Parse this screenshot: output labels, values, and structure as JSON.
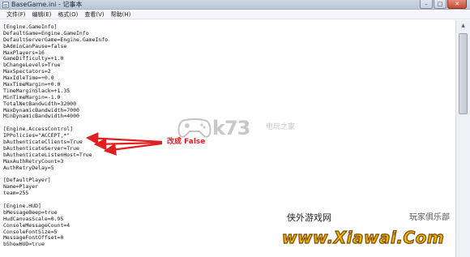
{
  "window": {
    "title": "BaseGame.ini - 记事本",
    "controls": {
      "minimize": "–",
      "maximize": "□",
      "close": "✕"
    }
  },
  "menu": [
    "文件(F)",
    "编辑(E)",
    "格式(O)",
    "查看(V)",
    "帮助(H)"
  ],
  "editor_lines": [
    "[Engine.GameInfo]",
    "DefaultGame=Engine.GameInfo",
    "DefaultServerGame=Engine.GameInfo",
    "bAdminCanPause=false",
    "MaxPlayers=16",
    "GameDifficulty=+1.0",
    "bChangeLevels=True",
    "MaxSpectators=2",
    "MaxIdleTime=+0.0",
    "MaxTimeMargin=+0.0",
    "TimeMarginSlack=+1.35",
    "MinTimeMargin=-1.0",
    "TotalNetBandwidth=32000",
    "MaxDynamicBandwidth=7000",
    "MinDynamicBandwidth=4000",
    "",
    "[Engine.AccessControl]",
    "IPPolicies=\"ACCEPT,*\"",
    "bAuthenticateClients=True",
    "bAuthenticateServer=True",
    "bAuthenticateListenHost=True",
    "MaxAuthRetryCount=3",
    "AuthRetryDelay=5",
    "",
    "[DefaultPlayer]",
    "Name=Player",
    "team=255",
    "",
    "[Engine.HUD]",
    "bMessageBeep=true",
    "HudCanvasScale=0.95",
    "ConsoleMessageCount=4",
    "ConsoleFontSize=5",
    "MessageFontOffset=0",
    "bShowHUD=true"
  ],
  "scrollbar": {
    "up_arrow": "▲"
  },
  "annotation": {
    "label": "改成 False",
    "color": "#e02020"
  },
  "watermarks": {
    "k73": "k73",
    "k73_sub": "电玩之家",
    "xiawai_cn": "侠外游戏网",
    "xiawai_right": "玩家俱乐部",
    "xiawai_logo": "www.Xiawai.Com"
  },
  "colors": {
    "title_gradient_top": "#ced7e3",
    "annotation_red": "#e02020",
    "xiawai_gold": "#f0b400"
  }
}
